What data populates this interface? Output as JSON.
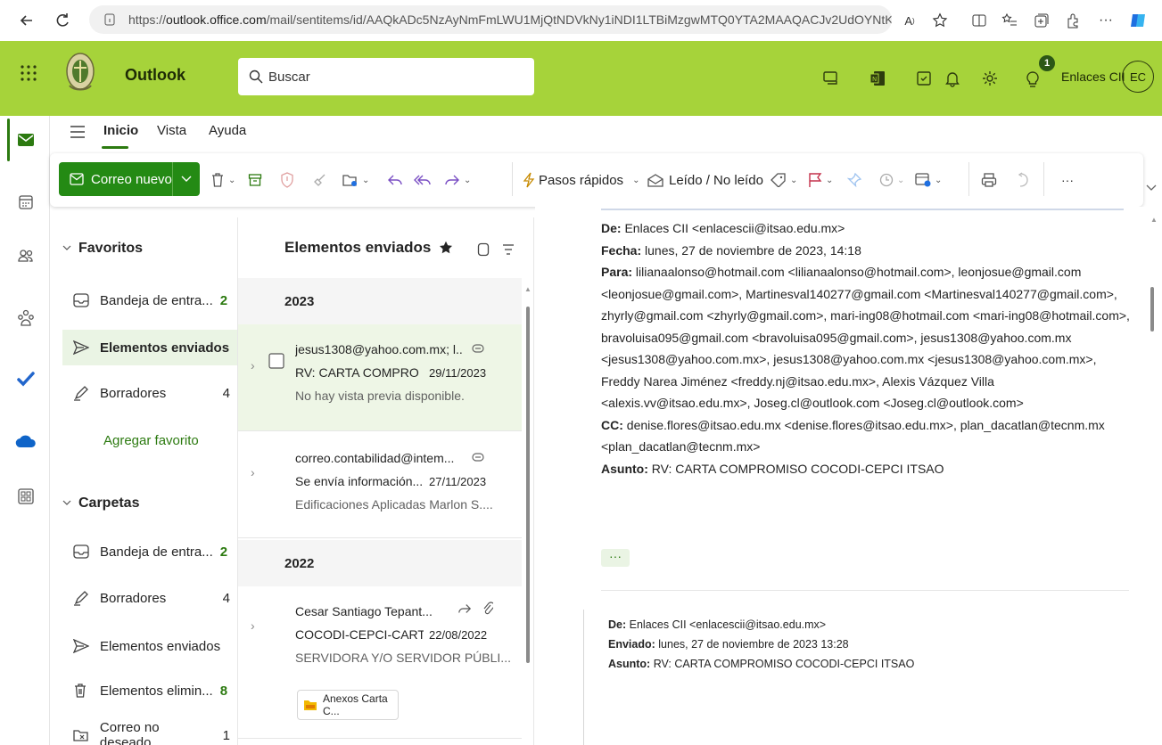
{
  "browser": {
    "url_prefix": "https://",
    "url_domain": "outlook.office.com",
    "url_rest": "/mail/sentitems/id/AAQkADc5NzAyNmFmLWU1MjQtNDVkNy1iNDI1LTBiMzgwMTQ0YTA2MAAQACJv2UdOYNtK..."
  },
  "header": {
    "app_title": "Outlook",
    "search_placeholder": "Buscar",
    "user_name": "Enlaces CII",
    "avatar_initials": "EC",
    "notification_count": "1",
    "brand_color": "#a6d33a"
  },
  "ribbon": {
    "tabs": [
      "Inicio",
      "Vista",
      "Ayuda"
    ],
    "new_mail_label": "Correo nuevo",
    "quick_steps_label": "Pasos rápidos",
    "read_unread_label": "Leído / No leído",
    "more_label": "···"
  },
  "folders": {
    "favorites_label": "Favoritos",
    "folders_label": "Carpetas",
    "add_favorite_label": "Agregar favorito",
    "favorites": [
      {
        "label": "Bandeja de entra...",
        "count": "2"
      },
      {
        "label": "Elementos enviados",
        "count": ""
      },
      {
        "label": "Borradores",
        "count": "4"
      }
    ],
    "items": [
      {
        "label": "Bandeja de entra...",
        "count": "2"
      },
      {
        "label": "Borradores",
        "count": "4"
      },
      {
        "label": "Elementos enviados",
        "count": ""
      },
      {
        "label": "Elementos elimin...",
        "count": "8"
      },
      {
        "label": "Correo no deseado",
        "count": "1"
      }
    ]
  },
  "message_list": {
    "title": "Elementos enviados",
    "groups": [
      "2023",
      "2022"
    ],
    "messages": [
      {
        "from": "jesus1308@yahoo.com.mx; l...",
        "subject": "RV: CARTA COMPRO...",
        "date": "29/11/2023",
        "preview": "No hay vista previa disponible."
      },
      {
        "from": "correo.contabilidad@intem...",
        "subject": "Se envía información...",
        "date": "27/11/2023",
        "preview": "Edificaciones Aplicadas Marlon S...."
      },
      {
        "from": "Cesar Santiago Tepant...",
        "subject": "COCODI-CEPCI-CART...",
        "date": "22/08/2022",
        "preview": "SERVIDORA Y/O SERVIDOR PÚBLI...",
        "attachment": "Anexos Carta C..."
      }
    ]
  },
  "reading": {
    "header": {
      "from_label": "De:",
      "from_value": "Enlaces CII <enlacescii@itsao.edu.mx>",
      "date_label": "Fecha:",
      "date_value": "lunes, 27 de noviembre de 2023, 14:18",
      "to_label": "Para:",
      "to_value": "lilianaalonso@hotmail.com <lilianaalonso@hotmail.com>, leonjosue@gmail.com <leonjosue@gmail.com>, Martinesval140277@gmail.com <Martinesval140277@gmail.com>, zhyrly@gmail.com <zhyrly@gmail.com>, mari-ing08@hotmail.com <mari-ing08@hotmail.com>, bravoluisa095@gmail.com <bravoluisa095@gmail.com>, jesus1308@yahoo.com.mx <jesus1308@yahoo.com.mx>, jesus1308@yahoo.com.mx <jesus1308@yahoo.com.mx>, Freddy Narea Jiménez <freddy.nj@itsao.edu.mx>, Alexis Vázquez Villa <alexis.vv@itsao.edu.mx>, Joseg.cl@outlook.com <Joseg.cl@outlook.com>",
      "cc_label": "CC:",
      "cc_value": "denise.flores@itsao.edu.mx <denise.flores@itsao.edu.mx>, plan_dacatlan@tecnm.mx <plan_dacatlan@tecnm.mx>",
      "subject_label": "Asunto:",
      "subject_value": "RV: CARTA COMPROMISO COCODI-CEPCI ITSAO"
    },
    "ellipsis": "···",
    "header2": {
      "from_label": "De:",
      "from_value": "Enlaces CII <enlacescii@itsao.edu.mx>",
      "sent_label": "Enviado:",
      "sent_value": "lunes, 27 de noviembre de 2023 13:28",
      "subject_label": "Asunto:",
      "subject_value": "RV: CARTA COMPROMISO COCODI-CEPCI ITSAO"
    }
  }
}
